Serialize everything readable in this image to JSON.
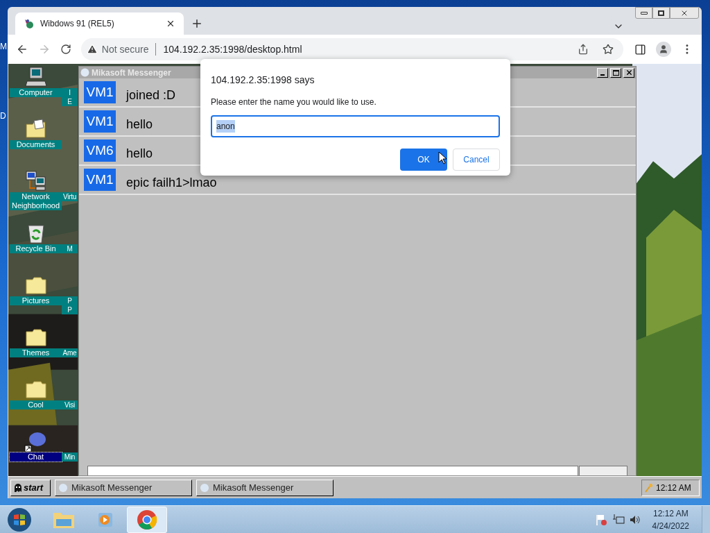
{
  "os_desktop": {
    "edge_labels": [
      "M",
      "D"
    ]
  },
  "browser": {
    "tab": {
      "title": "Wibdows 91 (REL5)",
      "selected": true
    },
    "forward_disabled": true,
    "address_bar": {
      "security": "Not secure",
      "url": "104.192.2.35:1998/desktop.html"
    }
  },
  "page": {
    "desktop_icons": [
      {
        "label": "Computer",
        "kind": "computer",
        "selected": false,
        "next_column_label": [
          "I",
          "E"
        ]
      },
      {
        "label": "Documents",
        "kind": "documents",
        "selected": false
      },
      {
        "label": "Network Neighborhood",
        "kind": "network",
        "selected": false,
        "next_column_label": [
          "Virtu"
        ]
      },
      {
        "label": "Recycle Bin",
        "kind": "recycle",
        "selected": false,
        "next_column_label": [
          "M"
        ]
      },
      {
        "label": "Pictures",
        "kind": "folder",
        "selected": false,
        "next_column_label": [
          "P",
          "P"
        ]
      },
      {
        "label": "Themes",
        "kind": "folder",
        "selected": false,
        "next_column_label": [
          "Ame"
        ]
      },
      {
        "label": "Cool",
        "kind": "folder",
        "selected": false,
        "next_column_label": [
          "Visi"
        ]
      },
      {
        "label": "Chat",
        "kind": "chat",
        "selected": true,
        "next_column_label": [
          "Min"
        ]
      }
    ],
    "messenger": {
      "title": "Mikasoft Messenger",
      "messages": [
        {
          "sender": "VM1",
          "text": "joined :D"
        },
        {
          "sender": "VM1",
          "text": "hello"
        },
        {
          "sender": "VM6",
          "text": "hello"
        },
        {
          "sender": "VM1",
          "text": "epic failh1>lmao"
        }
      ]
    },
    "taskbar": {
      "start": "start",
      "tasks": [
        {
          "title": "Mikasoft Messenger"
        },
        {
          "title": "Mikasoft Messenger"
        }
      ],
      "clock": "12:12 AM"
    }
  },
  "dialog": {
    "title": "104.192.2.35:1998 says",
    "message": "Please enter the name you would like to use.",
    "input_value": "anon",
    "value_selected": true,
    "buttons": [
      {
        "label": "OK",
        "kind": "primary"
      },
      {
        "label": "Cancel",
        "kind": "secondary"
      }
    ]
  },
  "taskbar": {
    "pinned": [
      {
        "kind": "explorer",
        "selected": false
      },
      {
        "kind": "media",
        "selected": false
      },
      {
        "kind": "chrome",
        "selected": true
      }
    ],
    "clock": {
      "time": "12:12 AM",
      "date": "4/24/2022"
    }
  }
}
